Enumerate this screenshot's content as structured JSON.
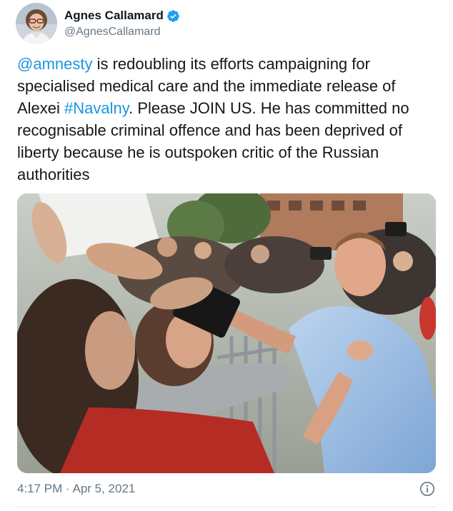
{
  "author": {
    "display_name": "Agnes Callamard",
    "handle": "@AgnesCallamard",
    "verified": true
  },
  "tweet": {
    "mention": "@amnesty",
    "text_part1": " is redoubling its efforts campaigning for specialised medical care and the immediate release of Alexei ",
    "hashtag": "#Navalny",
    "text_part2": ". Please JOIN US. He has committed no recognisable criminal offence and has been deprived of liberty because he is outspoken critic of the Russian authorities"
  },
  "media": {
    "kind": "photo"
  },
  "meta": {
    "timestamp": "4:17 PM · Apr 5, 2021"
  },
  "icons": {
    "verified": "verified-badge-icon",
    "info": "info-circle-icon"
  },
  "colors": {
    "link": "#1b95e0",
    "secondary_text": "#657786",
    "verified": "#1da1f2"
  }
}
